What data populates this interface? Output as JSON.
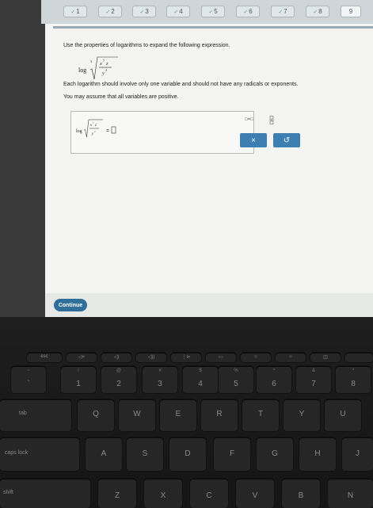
{
  "progress": {
    "steps": [
      {
        "label": "1",
        "done": true
      },
      {
        "label": "2",
        "done": true
      },
      {
        "label": "3",
        "done": true
      },
      {
        "label": "4",
        "done": true
      },
      {
        "label": "5",
        "done": true
      },
      {
        "label": "6",
        "done": true
      },
      {
        "label": "7",
        "done": true
      },
      {
        "label": "8",
        "done": true
      },
      {
        "label": "9",
        "done": false
      }
    ],
    "check_icon": "check-icon"
  },
  "question": {
    "prompt": "Use the properties of logarithms to expand the following expression.",
    "log_word": "log",
    "root_index": "3",
    "numerator": "x",
    "numerator_exp": "7",
    "numerator_var2": "z",
    "denominator": "y",
    "denominator_exp": "2",
    "instruction": "Each logarithm should involve only one variable and should not have any radicals or exponents.",
    "assumption": "You may assume that all variables are positive."
  },
  "answer": {
    "log_word": "log",
    "equals": "=",
    "placeholder_icon": "empty-box-icon"
  },
  "tools": {
    "log_template_label": "□=□",
    "fraction_template_label": "□/□",
    "clear_label": "×",
    "undo_label": "↺"
  },
  "footer": {
    "continue_label": "Continue"
  },
  "keyboard": {
    "fn_row": [
      "esc",
      "◁×",
      "◁)",
      "◁))",
      "⋮⊳",
      "▭",
      "☼",
      "☼",
      "◫",
      ""
    ],
    "number_row": [
      {
        "top": "~",
        "main": "`"
      },
      {
        "top": "!",
        "main": "1"
      },
      {
        "top": "@",
        "main": "2"
      },
      {
        "top": "#",
        "main": "3"
      },
      {
        "top": "$",
        "main": "4"
      },
      {
        "top": "%",
        "main": "5"
      },
      {
        "top": "^",
        "main": "6"
      },
      {
        "top": "&",
        "main": "7"
      },
      {
        "top": "*",
        "main": "8"
      }
    ],
    "tab_label": "tab",
    "q_row": [
      "Q",
      "W",
      "E",
      "R",
      "T",
      "Y",
      "U"
    ],
    "caps_label": "caps lock",
    "a_row": [
      "A",
      "S",
      "D",
      "F",
      "G",
      "H",
      "J"
    ],
    "shift_label": "shift",
    "z_row": [
      "Z",
      "X",
      "C",
      "V",
      "B",
      "N"
    ]
  }
}
